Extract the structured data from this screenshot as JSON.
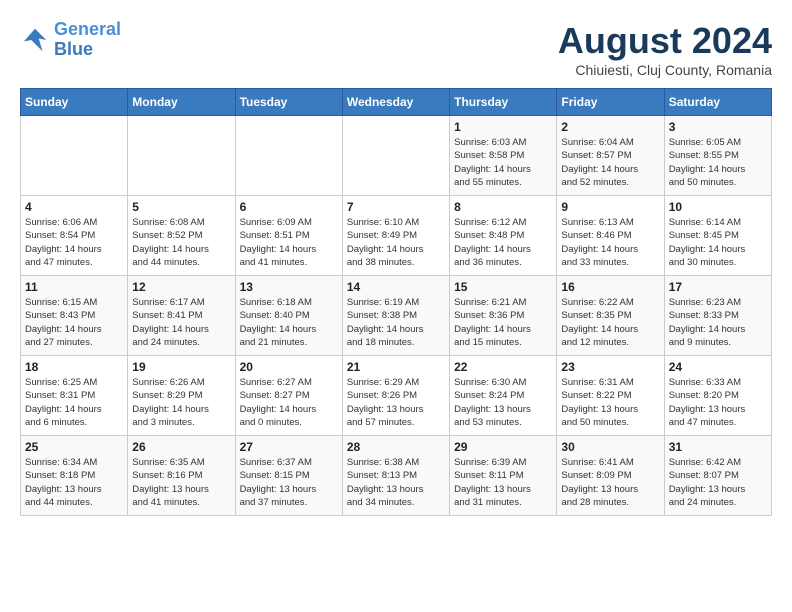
{
  "logo": {
    "line1": "General",
    "line2": "Blue"
  },
  "title": "August 2024",
  "subtitle": "Chiuiesti, Cluj County, Romania",
  "weekdays": [
    "Sunday",
    "Monday",
    "Tuesday",
    "Wednesday",
    "Thursday",
    "Friday",
    "Saturday"
  ],
  "weeks": [
    [
      {
        "day": "",
        "info": ""
      },
      {
        "day": "",
        "info": ""
      },
      {
        "day": "",
        "info": ""
      },
      {
        "day": "",
        "info": ""
      },
      {
        "day": "1",
        "info": "Sunrise: 6:03 AM\nSunset: 8:58 PM\nDaylight: 14 hours\nand 55 minutes."
      },
      {
        "day": "2",
        "info": "Sunrise: 6:04 AM\nSunset: 8:57 PM\nDaylight: 14 hours\nand 52 minutes."
      },
      {
        "day": "3",
        "info": "Sunrise: 6:05 AM\nSunset: 8:55 PM\nDaylight: 14 hours\nand 50 minutes."
      }
    ],
    [
      {
        "day": "4",
        "info": "Sunrise: 6:06 AM\nSunset: 8:54 PM\nDaylight: 14 hours\nand 47 minutes."
      },
      {
        "day": "5",
        "info": "Sunrise: 6:08 AM\nSunset: 8:52 PM\nDaylight: 14 hours\nand 44 minutes."
      },
      {
        "day": "6",
        "info": "Sunrise: 6:09 AM\nSunset: 8:51 PM\nDaylight: 14 hours\nand 41 minutes."
      },
      {
        "day": "7",
        "info": "Sunrise: 6:10 AM\nSunset: 8:49 PM\nDaylight: 14 hours\nand 38 minutes."
      },
      {
        "day": "8",
        "info": "Sunrise: 6:12 AM\nSunset: 8:48 PM\nDaylight: 14 hours\nand 36 minutes."
      },
      {
        "day": "9",
        "info": "Sunrise: 6:13 AM\nSunset: 8:46 PM\nDaylight: 14 hours\nand 33 minutes."
      },
      {
        "day": "10",
        "info": "Sunrise: 6:14 AM\nSunset: 8:45 PM\nDaylight: 14 hours\nand 30 minutes."
      }
    ],
    [
      {
        "day": "11",
        "info": "Sunrise: 6:15 AM\nSunset: 8:43 PM\nDaylight: 14 hours\nand 27 minutes."
      },
      {
        "day": "12",
        "info": "Sunrise: 6:17 AM\nSunset: 8:41 PM\nDaylight: 14 hours\nand 24 minutes."
      },
      {
        "day": "13",
        "info": "Sunrise: 6:18 AM\nSunset: 8:40 PM\nDaylight: 14 hours\nand 21 minutes."
      },
      {
        "day": "14",
        "info": "Sunrise: 6:19 AM\nSunset: 8:38 PM\nDaylight: 14 hours\nand 18 minutes."
      },
      {
        "day": "15",
        "info": "Sunrise: 6:21 AM\nSunset: 8:36 PM\nDaylight: 14 hours\nand 15 minutes."
      },
      {
        "day": "16",
        "info": "Sunrise: 6:22 AM\nSunset: 8:35 PM\nDaylight: 14 hours\nand 12 minutes."
      },
      {
        "day": "17",
        "info": "Sunrise: 6:23 AM\nSunset: 8:33 PM\nDaylight: 14 hours\nand 9 minutes."
      }
    ],
    [
      {
        "day": "18",
        "info": "Sunrise: 6:25 AM\nSunset: 8:31 PM\nDaylight: 14 hours\nand 6 minutes."
      },
      {
        "day": "19",
        "info": "Sunrise: 6:26 AM\nSunset: 8:29 PM\nDaylight: 14 hours\nand 3 minutes."
      },
      {
        "day": "20",
        "info": "Sunrise: 6:27 AM\nSunset: 8:27 PM\nDaylight: 14 hours\nand 0 minutes."
      },
      {
        "day": "21",
        "info": "Sunrise: 6:29 AM\nSunset: 8:26 PM\nDaylight: 13 hours\nand 57 minutes."
      },
      {
        "day": "22",
        "info": "Sunrise: 6:30 AM\nSunset: 8:24 PM\nDaylight: 13 hours\nand 53 minutes."
      },
      {
        "day": "23",
        "info": "Sunrise: 6:31 AM\nSunset: 8:22 PM\nDaylight: 13 hours\nand 50 minutes."
      },
      {
        "day": "24",
        "info": "Sunrise: 6:33 AM\nSunset: 8:20 PM\nDaylight: 13 hours\nand 47 minutes."
      }
    ],
    [
      {
        "day": "25",
        "info": "Sunrise: 6:34 AM\nSunset: 8:18 PM\nDaylight: 13 hours\nand 44 minutes."
      },
      {
        "day": "26",
        "info": "Sunrise: 6:35 AM\nSunset: 8:16 PM\nDaylight: 13 hours\nand 41 minutes."
      },
      {
        "day": "27",
        "info": "Sunrise: 6:37 AM\nSunset: 8:15 PM\nDaylight: 13 hours\nand 37 minutes."
      },
      {
        "day": "28",
        "info": "Sunrise: 6:38 AM\nSunset: 8:13 PM\nDaylight: 13 hours\nand 34 minutes."
      },
      {
        "day": "29",
        "info": "Sunrise: 6:39 AM\nSunset: 8:11 PM\nDaylight: 13 hours\nand 31 minutes."
      },
      {
        "day": "30",
        "info": "Sunrise: 6:41 AM\nSunset: 8:09 PM\nDaylight: 13 hours\nand 28 minutes."
      },
      {
        "day": "31",
        "info": "Sunrise: 6:42 AM\nSunset: 8:07 PM\nDaylight: 13 hours\nand 24 minutes."
      }
    ]
  ]
}
